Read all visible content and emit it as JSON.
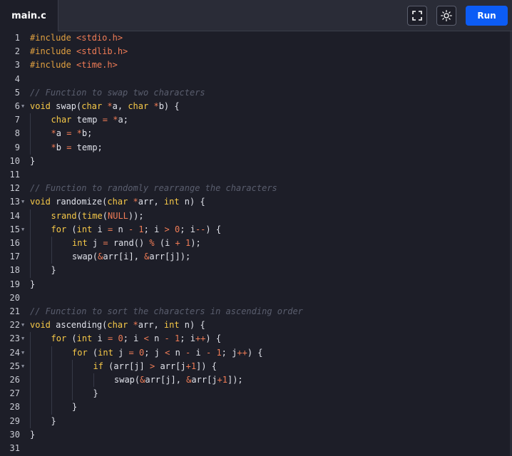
{
  "tab": {
    "label": "main.c"
  },
  "toolbar": {
    "fullscreen_icon": "fullscreen-icon",
    "theme_icon": "sun-icon",
    "run_label": "Run"
  },
  "colors": {
    "accent": "#0c5cf5",
    "background": "#1d1e28",
    "keyword": "#f7c948",
    "string": "#f07c56",
    "comment": "#5a5e6e"
  },
  "editor": {
    "lines": [
      {
        "n": "1",
        "fold": false,
        "indent": 0,
        "tokens": [
          [
            "inc",
            "#include "
          ],
          [
            "hdr",
            "<stdio.h>"
          ]
        ]
      },
      {
        "n": "2",
        "fold": false,
        "indent": 0,
        "tokens": [
          [
            "inc",
            "#include "
          ],
          [
            "hdr",
            "<stdlib.h>"
          ]
        ]
      },
      {
        "n": "3",
        "fold": false,
        "indent": 0,
        "tokens": [
          [
            "inc",
            "#include "
          ],
          [
            "hdr",
            "<time.h>"
          ]
        ]
      },
      {
        "n": "4",
        "fold": false,
        "indent": 0,
        "tokens": []
      },
      {
        "n": "5",
        "fold": false,
        "indent": 0,
        "tokens": [
          [
            "cm",
            "// Function to swap two characters"
          ]
        ]
      },
      {
        "n": "6",
        "fold": true,
        "indent": 0,
        "tokens": [
          [
            "kw",
            "void"
          ],
          [
            "pl",
            " swap("
          ],
          [
            "kw",
            "char"
          ],
          [
            "pl",
            " "
          ],
          [
            "op",
            "*"
          ],
          [
            "pl",
            "a, "
          ],
          [
            "kw",
            "char"
          ],
          [
            "pl",
            " "
          ],
          [
            "op",
            "*"
          ],
          [
            "pl",
            "b) {"
          ]
        ]
      },
      {
        "n": "7",
        "fold": false,
        "indent": 1,
        "tokens": [
          [
            "kw",
            "char"
          ],
          [
            "pl",
            " temp "
          ],
          [
            "op",
            "="
          ],
          [
            "pl",
            " "
          ],
          [
            "op",
            "*"
          ],
          [
            "pl",
            "a;"
          ]
        ]
      },
      {
        "n": "8",
        "fold": false,
        "indent": 1,
        "tokens": [
          [
            "op",
            "*"
          ],
          [
            "pl",
            "a "
          ],
          [
            "op",
            "="
          ],
          [
            "pl",
            " "
          ],
          [
            "op",
            "*"
          ],
          [
            "pl",
            "b;"
          ]
        ]
      },
      {
        "n": "9",
        "fold": false,
        "indent": 1,
        "tokens": [
          [
            "op",
            "*"
          ],
          [
            "pl",
            "b "
          ],
          [
            "op",
            "="
          ],
          [
            "pl",
            " temp;"
          ]
        ]
      },
      {
        "n": "10",
        "fold": false,
        "indent": 0,
        "tokens": [
          [
            "pl",
            "}"
          ]
        ]
      },
      {
        "n": "11",
        "fold": false,
        "indent": 0,
        "tokens": []
      },
      {
        "n": "12",
        "fold": false,
        "indent": 0,
        "tokens": [
          [
            "cm",
            "// Function to randomly rearrange the characters"
          ]
        ]
      },
      {
        "n": "13",
        "fold": true,
        "indent": 0,
        "tokens": [
          [
            "kw",
            "void"
          ],
          [
            "pl",
            " randomize("
          ],
          [
            "kw",
            "char"
          ],
          [
            "pl",
            " "
          ],
          [
            "op",
            "*"
          ],
          [
            "pl",
            "arr, "
          ],
          [
            "kw",
            "int"
          ],
          [
            "pl",
            " n) {"
          ]
        ]
      },
      {
        "n": "14",
        "fold": false,
        "indent": 1,
        "tokens": [
          [
            "kw",
            "srand"
          ],
          [
            "pl",
            "("
          ],
          [
            "kw",
            "time"
          ],
          [
            "pl",
            "("
          ],
          [
            "num",
            "NULL"
          ],
          [
            "pl",
            "));"
          ]
        ]
      },
      {
        "n": "15",
        "fold": true,
        "indent": 1,
        "tokens": [
          [
            "kw",
            "for"
          ],
          [
            "pl",
            " ("
          ],
          [
            "kw",
            "int"
          ],
          [
            "pl",
            " i "
          ],
          [
            "op",
            "="
          ],
          [
            "pl",
            " n "
          ],
          [
            "op",
            "-"
          ],
          [
            "pl",
            " "
          ],
          [
            "num",
            "1"
          ],
          [
            "pl",
            "; i "
          ],
          [
            "op",
            ">"
          ],
          [
            "pl",
            " "
          ],
          [
            "num",
            "0"
          ],
          [
            "pl",
            "; i"
          ],
          [
            "op",
            "--"
          ],
          [
            "pl",
            ") {"
          ]
        ]
      },
      {
        "n": "16",
        "fold": false,
        "indent": 2,
        "tokens": [
          [
            "kw",
            "int"
          ],
          [
            "pl",
            " j "
          ],
          [
            "op",
            "="
          ],
          [
            "pl",
            " rand() "
          ],
          [
            "op",
            "%"
          ],
          [
            "pl",
            " (i "
          ],
          [
            "op",
            "+"
          ],
          [
            "pl",
            " "
          ],
          [
            "num",
            "1"
          ],
          [
            "pl",
            ");"
          ]
        ]
      },
      {
        "n": "17",
        "fold": false,
        "indent": 2,
        "tokens": [
          [
            "pl",
            "swap("
          ],
          [
            "op",
            "&"
          ],
          [
            "pl",
            "arr[i], "
          ],
          [
            "op",
            "&"
          ],
          [
            "pl",
            "arr[j]);"
          ]
        ]
      },
      {
        "n": "18",
        "fold": false,
        "indent": 1,
        "tokens": [
          [
            "pl",
            "}"
          ]
        ]
      },
      {
        "n": "19",
        "fold": false,
        "indent": 0,
        "tokens": [
          [
            "pl",
            "}"
          ]
        ]
      },
      {
        "n": "20",
        "fold": false,
        "indent": 0,
        "tokens": []
      },
      {
        "n": "21",
        "fold": false,
        "indent": 0,
        "tokens": [
          [
            "cm",
            "// Function to sort the characters in ascending order"
          ]
        ]
      },
      {
        "n": "22",
        "fold": true,
        "indent": 0,
        "tokens": [
          [
            "kw",
            "void"
          ],
          [
            "pl",
            " ascending("
          ],
          [
            "kw",
            "char"
          ],
          [
            "pl",
            " "
          ],
          [
            "op",
            "*"
          ],
          [
            "pl",
            "arr, "
          ],
          [
            "kw",
            "int"
          ],
          [
            "pl",
            " n) {"
          ]
        ]
      },
      {
        "n": "23",
        "fold": true,
        "indent": 1,
        "tokens": [
          [
            "kw",
            "for"
          ],
          [
            "pl",
            " ("
          ],
          [
            "kw",
            "int"
          ],
          [
            "pl",
            " i "
          ],
          [
            "op",
            "="
          ],
          [
            "pl",
            " "
          ],
          [
            "num",
            "0"
          ],
          [
            "pl",
            "; i "
          ],
          [
            "op",
            "<"
          ],
          [
            "pl",
            " n "
          ],
          [
            "op",
            "-"
          ],
          [
            "pl",
            " "
          ],
          [
            "num",
            "1"
          ],
          [
            "pl",
            "; i"
          ],
          [
            "op",
            "++"
          ],
          [
            "pl",
            ") {"
          ]
        ]
      },
      {
        "n": "24",
        "fold": true,
        "indent": 2,
        "tokens": [
          [
            "kw",
            "for"
          ],
          [
            "pl",
            " ("
          ],
          [
            "kw",
            "int"
          ],
          [
            "pl",
            " j "
          ],
          [
            "op",
            "="
          ],
          [
            "pl",
            " "
          ],
          [
            "num",
            "0"
          ],
          [
            "pl",
            "; j "
          ],
          [
            "op",
            "<"
          ],
          [
            "pl",
            " n "
          ],
          [
            "op",
            "-"
          ],
          [
            "pl",
            " i "
          ],
          [
            "op",
            "-"
          ],
          [
            "pl",
            " "
          ],
          [
            "num",
            "1"
          ],
          [
            "pl",
            "; j"
          ],
          [
            "op",
            "++"
          ],
          [
            "pl",
            ") {"
          ]
        ]
      },
      {
        "n": "25",
        "fold": true,
        "indent": 3,
        "tokens": [
          [
            "kw",
            "if"
          ],
          [
            "pl",
            " (arr[j] "
          ],
          [
            "op",
            ">"
          ],
          [
            "pl",
            " arr[j"
          ],
          [
            "op",
            "+"
          ],
          [
            "num",
            "1"
          ],
          [
            "pl",
            "]) {"
          ]
        ]
      },
      {
        "n": "26",
        "fold": false,
        "indent": 4,
        "tokens": [
          [
            "pl",
            "swap("
          ],
          [
            "op",
            "&"
          ],
          [
            "pl",
            "arr[j], "
          ],
          [
            "op",
            "&"
          ],
          [
            "pl",
            "arr[j"
          ],
          [
            "op",
            "+"
          ],
          [
            "num",
            "1"
          ],
          [
            "pl",
            "]);"
          ]
        ]
      },
      {
        "n": "27",
        "fold": false,
        "indent": 3,
        "tokens": [
          [
            "pl",
            "}"
          ]
        ]
      },
      {
        "n": "28",
        "fold": false,
        "indent": 2,
        "tokens": [
          [
            "pl",
            "}"
          ]
        ]
      },
      {
        "n": "29",
        "fold": false,
        "indent": 1,
        "tokens": [
          [
            "pl",
            "}"
          ]
        ]
      },
      {
        "n": "30",
        "fold": false,
        "indent": 0,
        "tokens": [
          [
            "pl",
            "}"
          ]
        ]
      },
      {
        "n": "31",
        "fold": false,
        "indent": 0,
        "tokens": []
      }
    ]
  }
}
